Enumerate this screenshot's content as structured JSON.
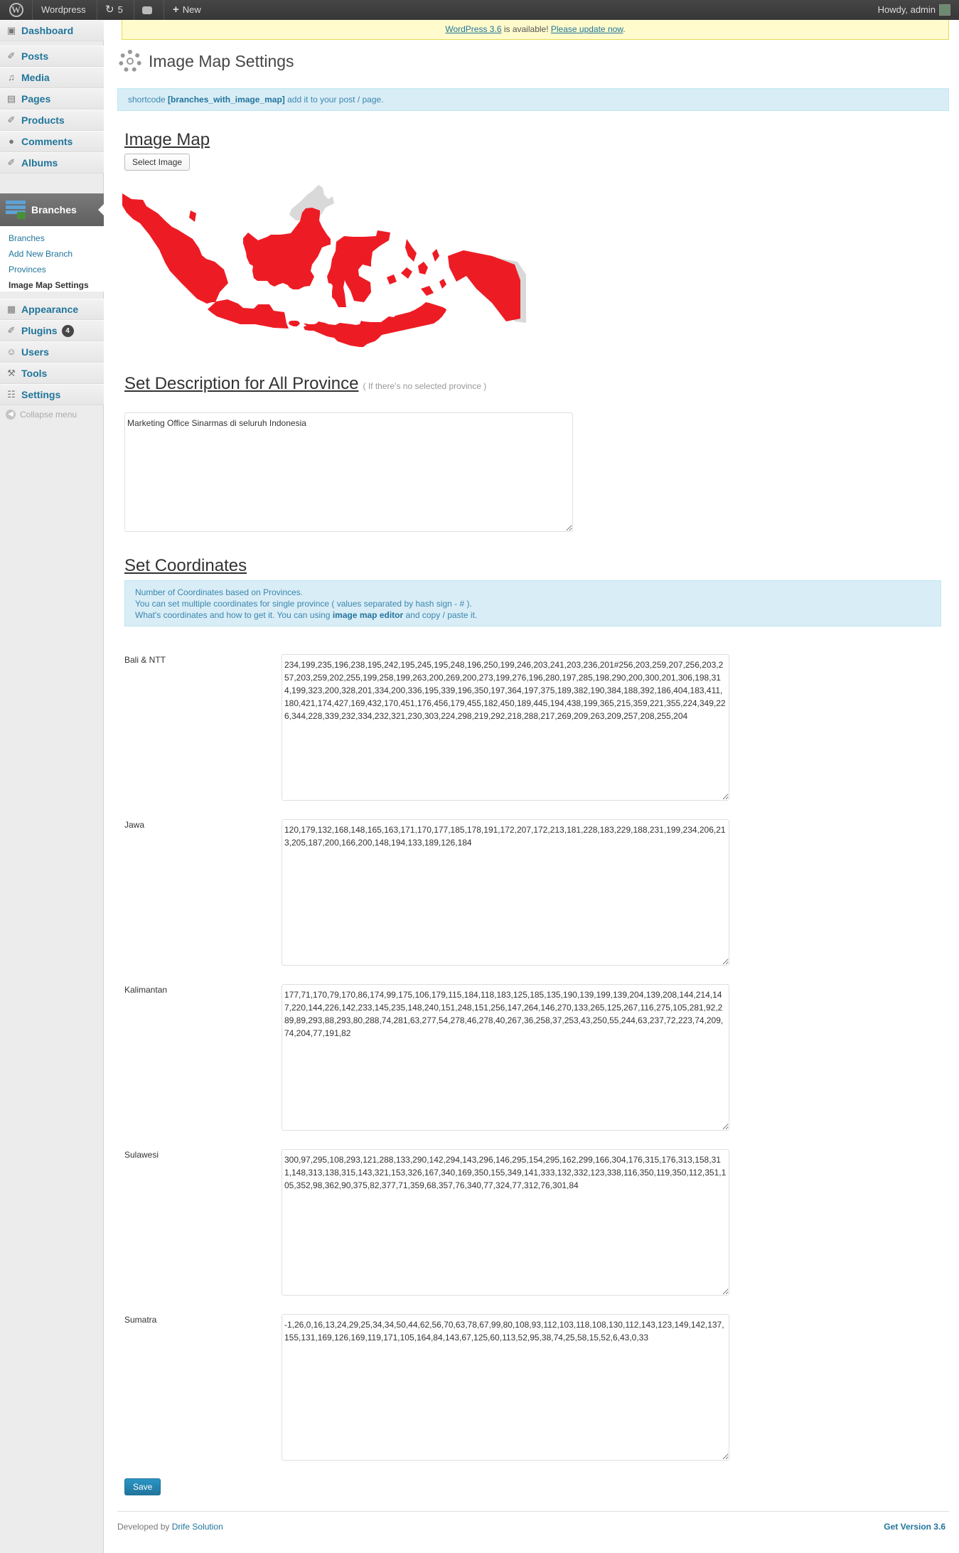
{
  "adminbar": {
    "site_name": "Wordpress",
    "updates_count": "5",
    "new_label": "New",
    "howdy": "Howdy, admin"
  },
  "sidebar": {
    "items_top": [
      {
        "label": "Dashboard",
        "icon": "dashboard-icon"
      },
      {
        "label": "Posts",
        "icon": "pin-icon"
      },
      {
        "label": "Media",
        "icon": "media-icon"
      },
      {
        "label": "Pages",
        "icon": "pages-icon"
      },
      {
        "label": "Products",
        "icon": "pin-icon"
      },
      {
        "label": "Comments",
        "icon": "comments-icon"
      },
      {
        "label": "Albums",
        "icon": "pin-icon"
      }
    ],
    "branches_label": "Branches",
    "submenu": [
      "Branches",
      "Add New Branch",
      "Provinces",
      "Image Map Settings"
    ],
    "items_bottom": [
      {
        "label": "Appearance",
        "icon": "appearance-icon"
      },
      {
        "label": "Plugins",
        "icon": "plugins-icon",
        "badge": "4"
      },
      {
        "label": "Users",
        "icon": "users-icon"
      },
      {
        "label": "Tools",
        "icon": "tools-icon"
      },
      {
        "label": "Settings",
        "icon": "settings-icon"
      }
    ],
    "collapse_label": "Collapse menu"
  },
  "update_nag": {
    "version_link": "WordPress 3.6",
    "middle_text": " is available! ",
    "update_link": "Please update now",
    "end": "."
  },
  "page": {
    "title": "Image Map Settings",
    "shortcode_prefix": "shortcode ",
    "shortcode": "[branches_with_image_map]",
    "shortcode_suffix": " add it to your post / page."
  },
  "image_map": {
    "title": "Image Map",
    "select_button": "Select Image"
  },
  "description": {
    "title": "Set Description for All Province",
    "hint": "( If there's no selected province )",
    "value": "Marketing Office Sinarmas di seluruh Indonesia"
  },
  "coordinates": {
    "title": "Set Coordinates",
    "info_line1": "Number of Coordinates based on Provinces.",
    "info_line2": "You can set multiple coordinates for single province ( values separated by hash sign - # ).",
    "info_line3_pre": "What's coordinates and how to get it. You can using ",
    "info_line3_link": "image map editor",
    "info_line3_post": " and copy / paste it.",
    "provinces": [
      {
        "name": "Bali & NTT",
        "value": "234,199,235,196,238,195,242,195,245,195,248,196,250,199,246,203,241,203,236,201#256,203,259,207,256,203,257,203,259,202,255,199,258,199,263,200,269,200,273,199,276,196,280,197,285,198,290,200,300,201,306,198,314,199,323,200,328,201,334,200,336,195,339,196,350,197,364,197,375,189,382,190,384,188,392,186,404,183,411,180,421,174,427,169,432,170,451,176,456,179,455,182,450,189,445,194,438,199,365,215,359,221,355,224,349,226,344,228,339,232,334,232,321,230,303,224,298,219,292,218,288,217,269,209,263,209,257,208,255,204"
      },
      {
        "name": "Jawa",
        "value": "120,179,132,168,148,165,163,171,170,177,185,178,191,172,207,172,213,181,228,183,229,188,231,199,234,206,213,205,187,200,166,200,148,194,133,189,126,184"
      },
      {
        "name": "Kalimantan",
        "value": "177,71,170,79,170,86,174,99,175,106,179,115,184,118,183,125,185,135,190,139,199,139,204,139,208,144,214,147,220,144,226,142,233,145,235,148,240,151,248,151,256,147,264,146,270,133,265,125,267,116,275,105,281,92,289,89,293,88,293,80,288,74,281,63,277,54,278,46,278,40,267,36,258,37,253,43,250,55,244,63,237,72,223,74,209,74,204,77,191,82"
      },
      {
        "name": "Sulawesi",
        "value": "300,97,295,108,293,121,288,133,290,142,294,143,296,146,295,154,295,162,299,166,304,176,315,176,313,158,311,148,313,138,315,143,321,153,326,167,340,169,350,155,349,141,333,132,332,123,338,116,350,119,350,112,351,105,352,98,362,90,375,82,377,71,359,68,357,76,340,77,324,77,312,76,301,84"
      },
      {
        "name": "Sumatra",
        "value": "-1,26,0,16,13,24,29,25,34,34,50,44,62,56,70,63,78,67,99,80,108,93,112,103,118,108,130,112,143,123,149,142,137,155,131,169,126,169,119,171,105,164,84,143,67,125,60,113,52,95,38,74,25,58,15,52,6,43,0,33"
      }
    ]
  },
  "save_label": "Save",
  "footer": {
    "developed_by": "Developed by ",
    "developer": "Drife Solution",
    "version": "Get Version 3.6"
  },
  "colors": {
    "accent": "#21759b",
    "map_red": "#ed1c24",
    "map_grey": "#d9d9d9"
  }
}
